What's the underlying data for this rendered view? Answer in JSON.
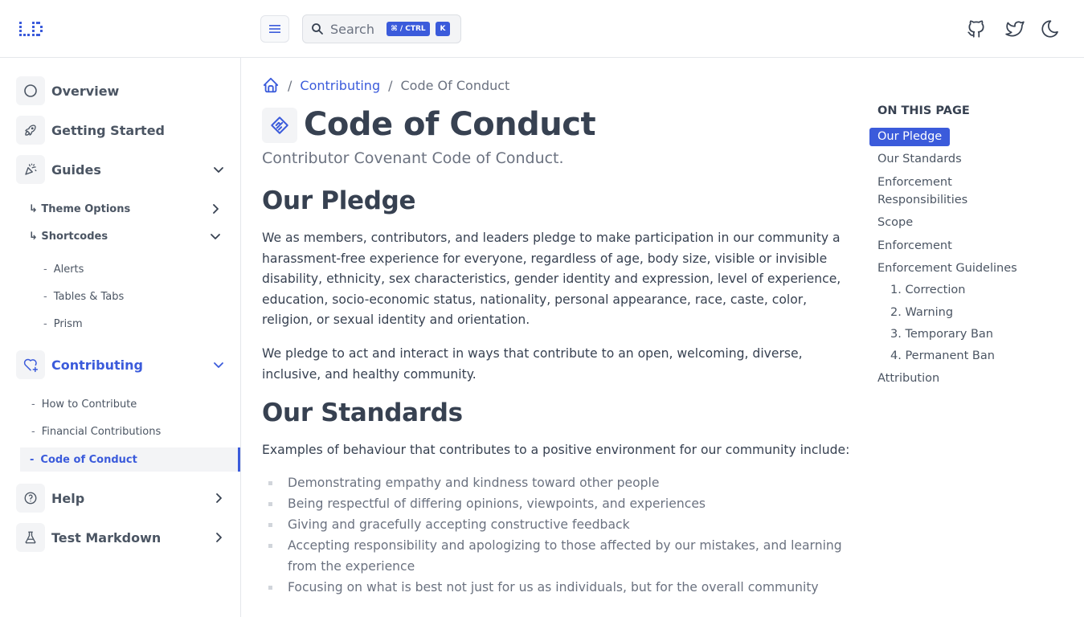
{
  "header": {
    "search_placeholder": "Search",
    "search_shortcut": "⌘ / CTRL",
    "search_key": "K"
  },
  "sidebar": {
    "items": [
      {
        "label": "Overview",
        "icon": "circle-icon"
      },
      {
        "label": "Getting Started",
        "icon": "rocket-icon"
      },
      {
        "label": "Guides",
        "icon": "confetti-icon"
      },
      {
        "label": "Contributing",
        "icon": "heart-plus-icon"
      },
      {
        "label": "Help",
        "icon": "help-circle-icon"
      },
      {
        "label": "Test Markdown",
        "icon": "flask-icon"
      }
    ],
    "guides_children": [
      {
        "label": "↳ Theme Options"
      },
      {
        "label": "↳ Shortcodes"
      }
    ],
    "shortcodes_children": [
      "Alerts",
      "Tables & Tabs",
      "Prism"
    ],
    "contributing_children": [
      "How to Contribute",
      "Financial Contributions",
      "Code of Conduct"
    ],
    "dash": "-"
  },
  "breadcrumb": {
    "separator": "/",
    "parent": "Contributing",
    "current": "Code Of Conduct"
  },
  "page": {
    "title": "Code of Conduct",
    "lead": "Contributor Covenant Code of Conduct.",
    "h2_pledge": "Our Pledge",
    "pledge_p1": "We as members, contributors, and leaders pledge to make participation in our community a harassment-free experience for everyone, regardless of age, body size, visible or invisible disability, ethnicity, sex characteristics, gender identity and expression, level of experience, education, socio-economic status, nationality, personal appearance, race, caste, color, religion, or sexual identity and orientation.",
    "pledge_p2": "We pledge to act and interact in ways that contribute to an open, welcoming, diverse, inclusive, and healthy community.",
    "h2_standards": "Our Standards",
    "standards_intro": "Examples of behaviour that contributes to a positive environment for our community include:",
    "standards_list": [
      "Demonstrating empathy and kindness toward other people",
      "Being respectful of differing opinions, viewpoints, and experiences",
      "Giving and gracefully accepting constructive feedback",
      "Accepting responsibility and apologizing to those affected by our mistakes, and learning from the experience",
      "Focusing on what is best not just for us as individuals, but for the overall community"
    ]
  },
  "toc": {
    "title": "ON THIS PAGE",
    "items": [
      "Our Pledge",
      "Our Standards",
      "Enforcement Responsibilities",
      "Scope",
      "Enforcement",
      "Enforcement Guidelines",
      "1. Correction",
      "2. Warning",
      "3. Temporary Ban",
      "4. Permanent Ban",
      "Attribution"
    ]
  },
  "colors": {
    "accent": "#3b5bdb",
    "text": "#374151",
    "muted": "#6b7280"
  }
}
